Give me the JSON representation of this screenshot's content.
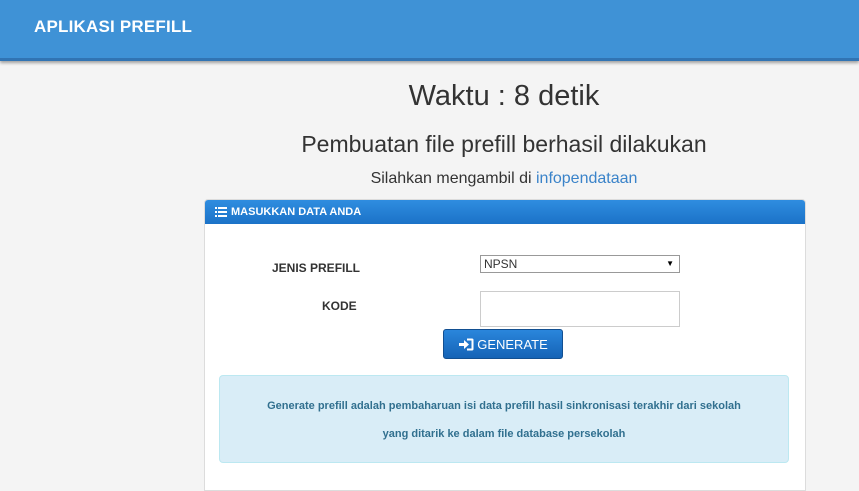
{
  "navbar": {
    "brand": "APLIKASI PREFILL"
  },
  "status": {
    "timer": "Waktu : 8 detik",
    "success_message": "Pembuatan file prefill berhasil dilakukan",
    "instruction_prefix": "Silahkan mengambil di ",
    "instruction_link": "infopendataan"
  },
  "panel": {
    "heading": "MASUKKAN DATA ANDA",
    "heading_icon": "list-icon",
    "jenis_label": "JENIS PREFILL",
    "jenis_value": "NPSN",
    "kode_label": "KODE",
    "kode_value": "",
    "generate_label": "GENERATE",
    "generate_icon": "sign-in-icon",
    "info_line1": "Generate prefill adalah pembaharuan isi data prefill hasil sinkronisasi terakhir dari sekolah",
    "info_line2": "yang ditarik ke dalam file database persekolah"
  },
  "colors": {
    "navbar": "#3f92d6",
    "panel_heading": "#1b72c8",
    "link": "#3a83c9",
    "info_bg": "#d9edf7",
    "info_text": "#31708f"
  }
}
